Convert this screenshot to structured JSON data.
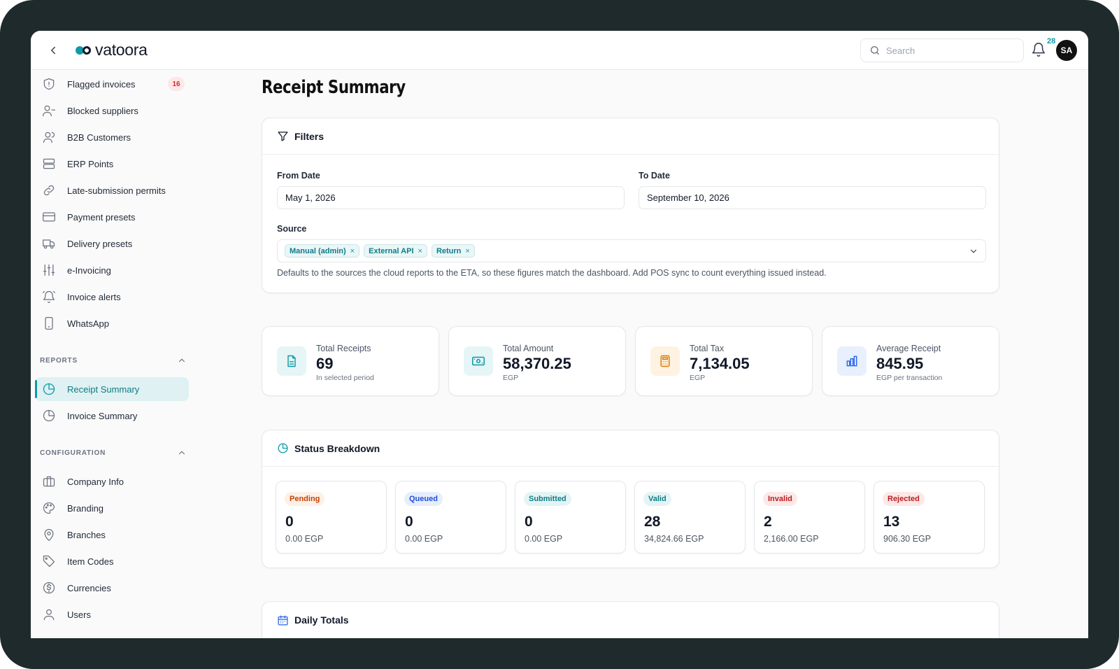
{
  "header": {
    "brand": "vatoora",
    "search_placeholder": "Search",
    "notification_count": "28",
    "avatar_initials": "SA"
  },
  "sidebar": {
    "items": [
      {
        "label": "Flagged invoices",
        "icon": "shield-alert-icon",
        "badge": "16"
      },
      {
        "label": "Blocked suppliers",
        "icon": "user-minus-icon"
      },
      {
        "label": "B2B Customers",
        "icon": "users-icon"
      },
      {
        "label": "ERP Points",
        "icon": "server-icon"
      },
      {
        "label": "Late-submission permits",
        "icon": "link-icon"
      },
      {
        "label": "Payment presets",
        "icon": "credit-card-icon"
      },
      {
        "label": "Delivery presets",
        "icon": "truck-icon"
      },
      {
        "label": "e-Invoicing",
        "icon": "sliders-icon"
      },
      {
        "label": "Invoice alerts",
        "icon": "bell-ring-icon"
      },
      {
        "label": "WhatsApp",
        "icon": "smartphone-icon"
      }
    ],
    "reports_heading": "REPORTS",
    "reports": [
      {
        "label": "Receipt Summary",
        "icon": "pie-chart-icon",
        "active": true
      },
      {
        "label": "Invoice Summary",
        "icon": "pie-chart-icon"
      }
    ],
    "config_heading": "CONFIGURATION",
    "config": [
      {
        "label": "Company Info",
        "icon": "briefcase-icon"
      },
      {
        "label": "Branding",
        "icon": "palette-icon"
      },
      {
        "label": "Branches",
        "icon": "map-pin-icon"
      },
      {
        "label": "Item Codes",
        "icon": "tag-icon"
      },
      {
        "label": "Currencies",
        "icon": "dollar-circle-icon"
      },
      {
        "label": "Users",
        "icon": "user-icon"
      }
    ]
  },
  "page": {
    "title": "Receipt Summary"
  },
  "filters": {
    "title": "Filters",
    "from_label": "From Date",
    "from_value": "May 1, 2026",
    "to_label": "To Date",
    "to_value": "September 10, 2026",
    "source_label": "Source",
    "sources": [
      "Manual (admin)",
      "External API",
      "Return"
    ],
    "helper": "Defaults to the sources the cloud reports to the ETA, so these figures match the dashboard. Add POS sync to count everything issued instead."
  },
  "stats": [
    {
      "label": "Total Receipts",
      "value": "69",
      "sub": "In selected period",
      "icon": "file-text-icon",
      "color": "#0e9aa7",
      "bg": "#e6f5f6"
    },
    {
      "label": "Total Amount",
      "value": "58,370.25",
      "sub": "EGP",
      "icon": "banknote-icon",
      "color": "#0e9aa7",
      "bg": "#e6f5f6"
    },
    {
      "label": "Total Tax",
      "value": "7,134.05",
      "sub": "EGP",
      "icon": "calculator-icon",
      "color": "#d97706",
      "bg": "#fef3e2"
    },
    {
      "label": "Average Receipt",
      "value": "845.95",
      "sub": "EGP per transaction",
      "icon": "bar-chart-icon",
      "color": "#2563eb",
      "bg": "#e8effd"
    }
  ],
  "status_breakdown": {
    "title": "Status Breakdown",
    "items": [
      {
        "label": "Pending",
        "count": "0",
        "amount": "0.00 EGP",
        "fg": "#c2410c",
        "bg": "#fdf0e4"
      },
      {
        "label": "Queued",
        "count": "0",
        "amount": "0.00 EGP",
        "fg": "#1d4ed8",
        "bg": "#e6eefc"
      },
      {
        "label": "Submitted",
        "count": "0",
        "amount": "0.00 EGP",
        "fg": "#0e7c86",
        "bg": "#e4f4f5"
      },
      {
        "label": "Valid",
        "count": "28",
        "amount": "34,824.66 EGP",
        "fg": "#0e7c86",
        "bg": "#e4f4f5"
      },
      {
        "label": "Invalid",
        "count": "2",
        "amount": "2,166.00 EGP",
        "fg": "#b91c1c",
        "bg": "#fde8e8"
      },
      {
        "label": "Rejected",
        "count": "13",
        "amount": "906.30 EGP",
        "fg": "#b91c1c",
        "bg": "#fde8e8"
      }
    ]
  },
  "daily_totals": {
    "title": "Daily Totals"
  },
  "colors": {
    "accent": "#0e9aa7",
    "device_frame": "#1f2a2c"
  }
}
